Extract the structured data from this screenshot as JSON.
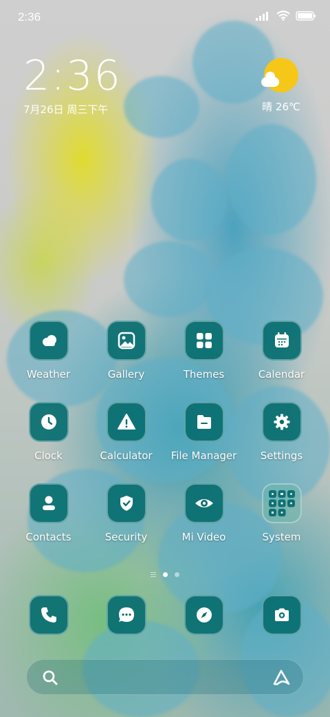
{
  "status_bar": {
    "time": "2:36"
  },
  "clock_widget": {
    "time": "2:36",
    "date": "7月26日 周三下午"
  },
  "weather_widget": {
    "text": "晴 26℃",
    "sun_color": "#f5c719"
  },
  "apps": [
    {
      "label": "Weather",
      "icon": "weather-icon"
    },
    {
      "label": "Gallery",
      "icon": "gallery-icon"
    },
    {
      "label": "Themes",
      "icon": "themes-icon"
    },
    {
      "label": "Calendar",
      "icon": "calendar-icon"
    },
    {
      "label": "Clock",
      "icon": "clock-icon"
    },
    {
      "label": "Calculator",
      "icon": "calculator-icon"
    },
    {
      "label": "File Manager",
      "icon": "file-manager-icon"
    },
    {
      "label": "Settings",
      "icon": "settings-icon"
    },
    {
      "label": "Contacts",
      "icon": "contacts-icon"
    },
    {
      "label": "Security",
      "icon": "security-icon"
    },
    {
      "label": "Mi Video",
      "icon": "mi-video-icon"
    },
    {
      "label": "System",
      "icon": "system-folder-icon"
    }
  ],
  "dock": [
    {
      "icon": "phone-icon"
    },
    {
      "icon": "messages-icon"
    },
    {
      "icon": "browser-icon"
    },
    {
      "icon": "camera-icon"
    }
  ],
  "page_indicator": {
    "pages": 2,
    "current": 1
  },
  "colors": {
    "icon_bg": "#086e70",
    "text": "#ffffff"
  }
}
